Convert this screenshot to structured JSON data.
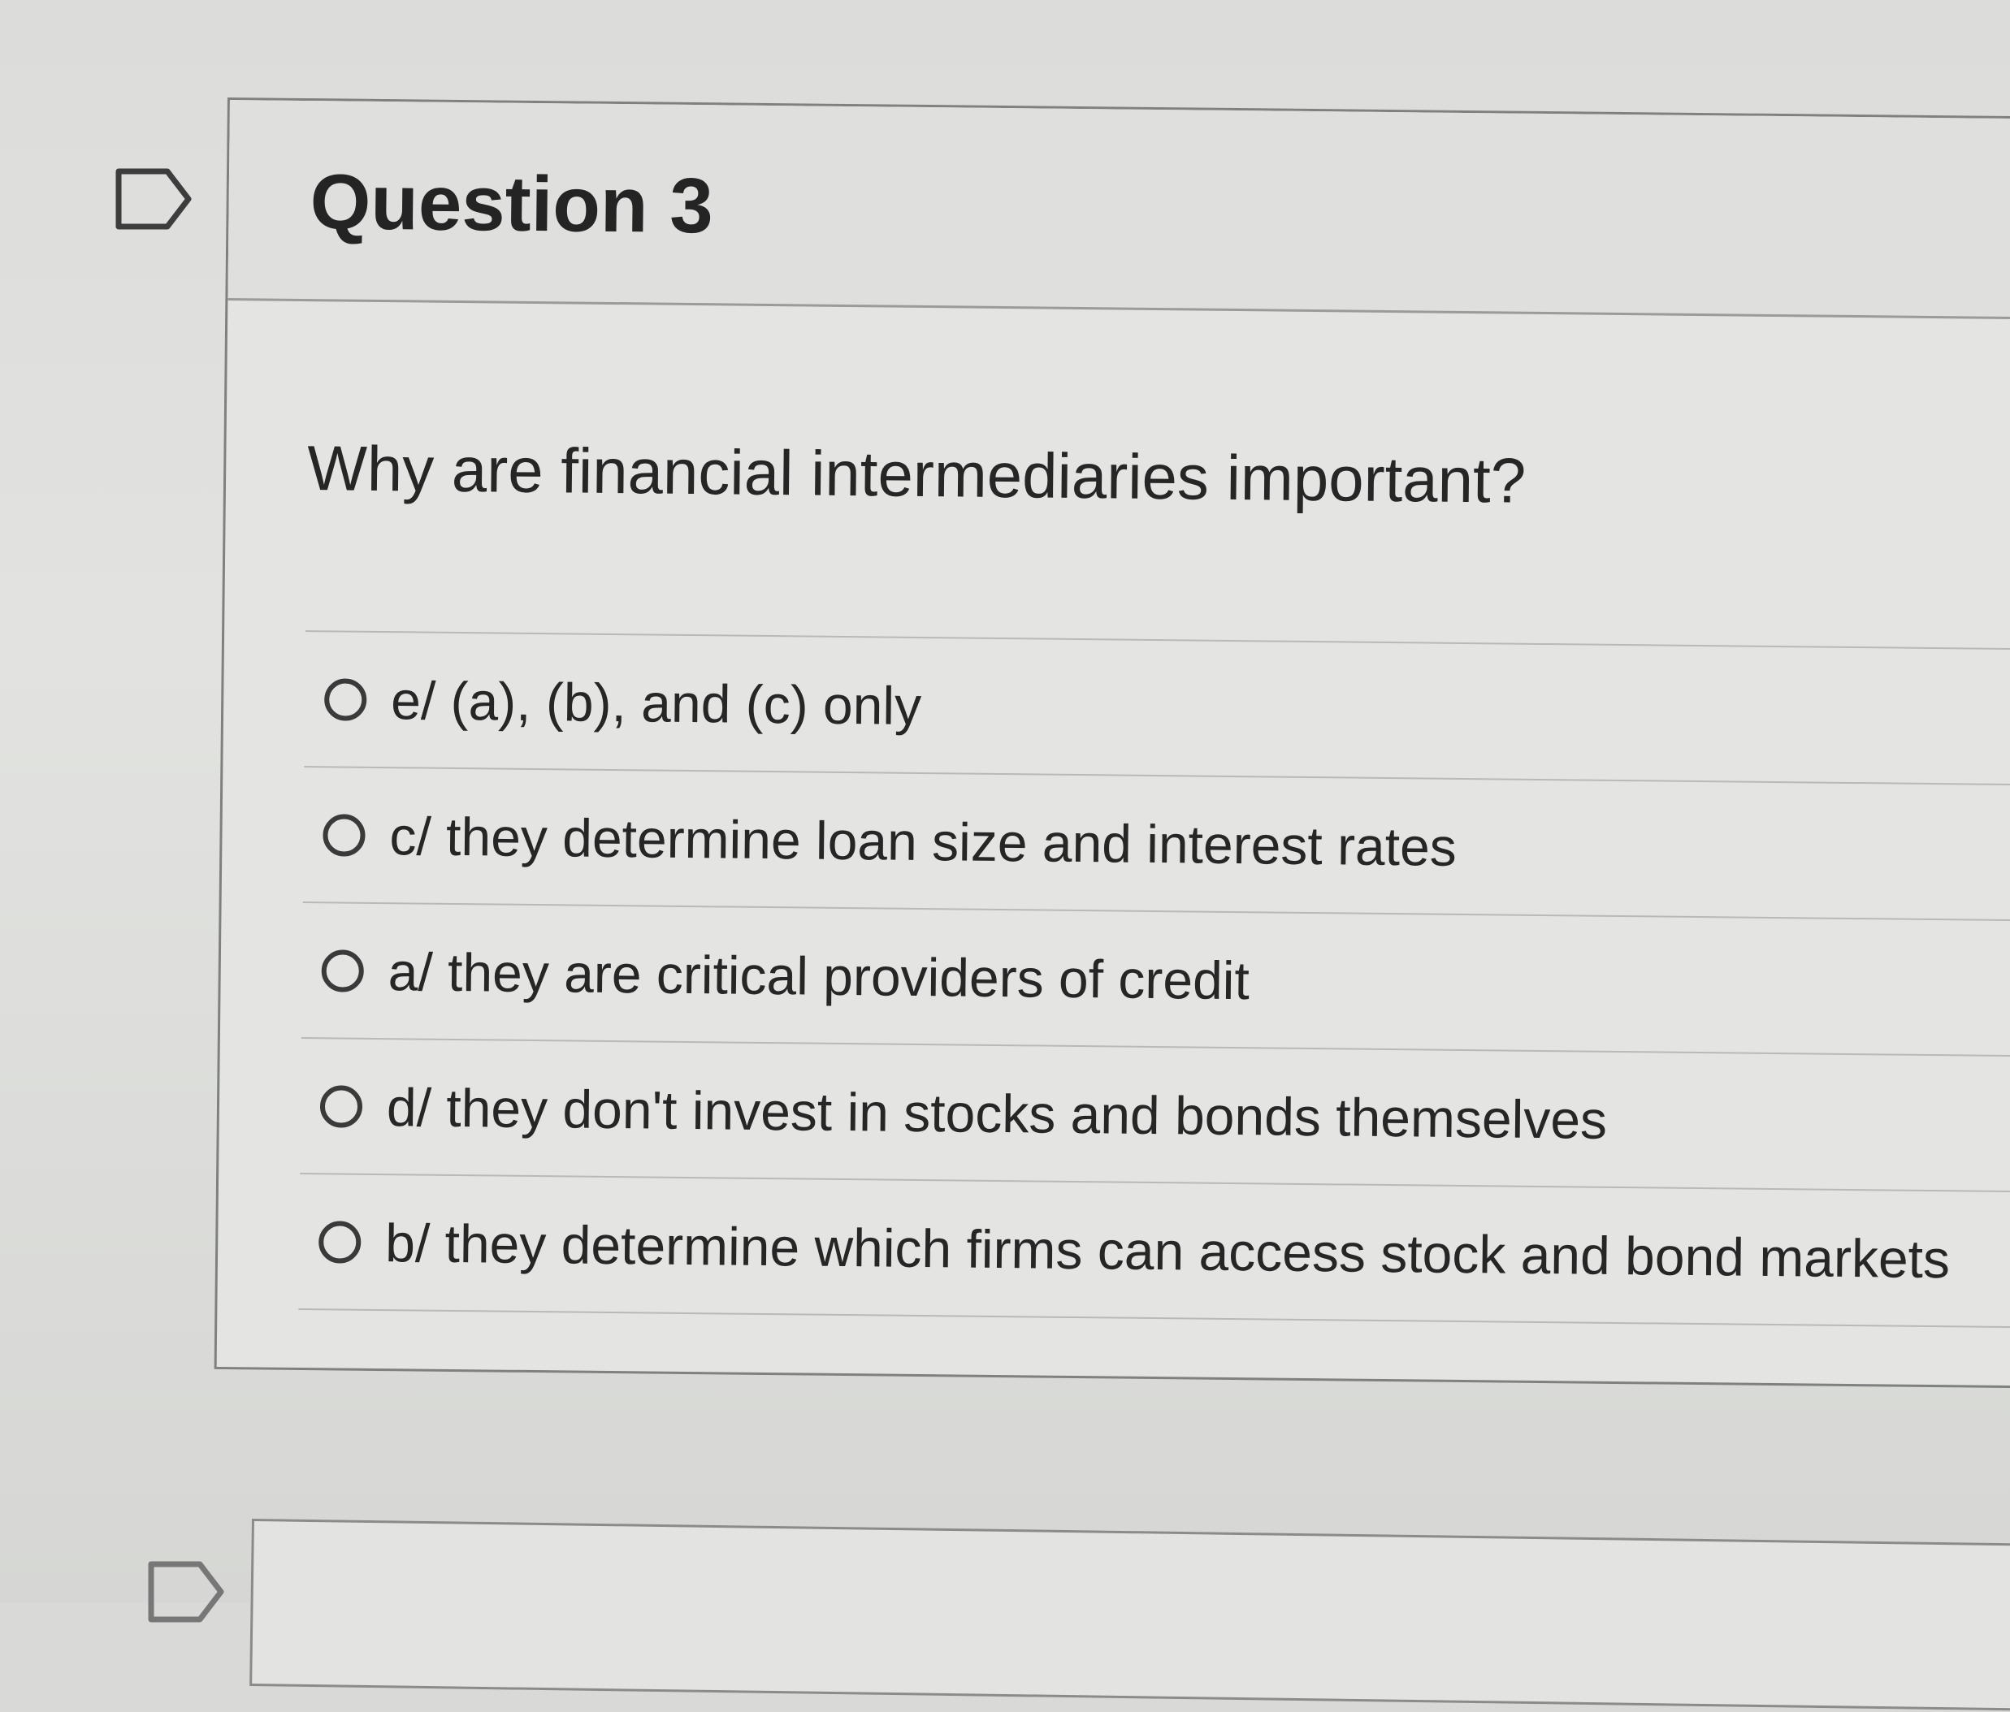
{
  "question": {
    "title": "Question 3",
    "prompt": "Why are financial intermediaries important?",
    "answers": [
      {
        "label": "e/ (a), (b), and (c) only"
      },
      {
        "label": "c/ they determine loan size and interest rates"
      },
      {
        "label": "a/ they are critical providers of credit"
      },
      {
        "label": "d/ they don't invest in stocks and bonds themselves"
      },
      {
        "label": "b/ they determine which firms can access stock and bond markets"
      }
    ]
  },
  "icons": {
    "flag": "flag-icon",
    "radio": "radio-button-icon"
  },
  "colors": {
    "border": "#7f8180",
    "text": "#262626",
    "background": "#e4e5e2"
  }
}
